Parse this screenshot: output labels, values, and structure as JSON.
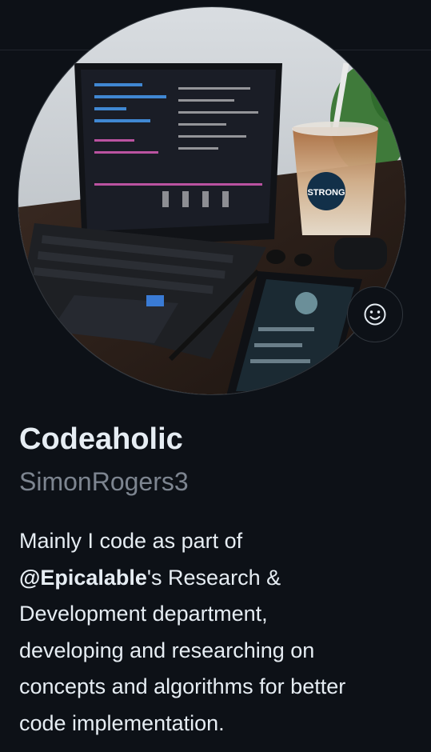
{
  "profile": {
    "display_name": "Codeaholic",
    "username": "SimonRogers3",
    "avatar_alt": "Laptop with code on screen, iced coffee, phone and earbuds on a wooden desk",
    "cup_logo_text": "STRONG",
    "status_icon": "smiley-face-icon",
    "bio": {
      "line1": "Mainly I code as part of",
      "mention": "@Epicalable",
      "line2_rest": "'s Research &",
      "line3": "Development department,",
      "line4": "developing and researching on",
      "line5": "concepts and algorithms for better",
      "line6": "code implementation."
    }
  },
  "colors": {
    "background": "#0d1117",
    "text_primary": "#e6edf3",
    "text_muted": "#7d8590",
    "border": "#30363d"
  }
}
